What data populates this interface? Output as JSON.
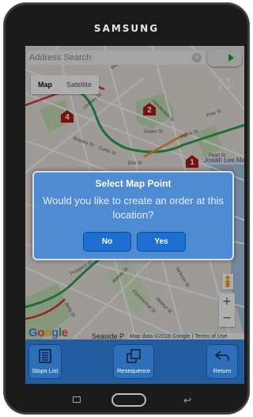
{
  "device": {
    "brand": "SAMSUNG"
  },
  "map": {
    "search_placeholder": "Address Search",
    "maptype": {
      "map_label": "Map",
      "satellite_label": "Satellite",
      "selected": "Map"
    },
    "pins": [
      {
        "number": "4"
      },
      {
        "number": "2"
      },
      {
        "number": "1"
      }
    ],
    "google_logo": "Google",
    "attribution": "Map data ©2018 Google | Terms of Use",
    "place_label": "Seaside P",
    "street_labels": [
      "Green St",
      "Curtis St",
      "Elm St",
      "Harris St",
      "Prospect St",
      "Commercial St",
      "Walnut St",
      "Market St",
      "Henderson St",
      "Pine St",
      "Pearl St",
      "Jerry St",
      "Bowers St",
      "Lindsey St",
      "Jackson St",
      "Maple St"
    ],
    "poi_label": "Josiah Lee Ma",
    "colors": {
      "pin": "#b0181a",
      "route_green": "#2ea44f",
      "route_red": "#d9352b",
      "water": "#a8c8e8"
    }
  },
  "dialog": {
    "title": "Select Map Point",
    "message": "Would you like to create an order at this location?",
    "no_label": "No",
    "yes_label": "Yes"
  },
  "toolbar": {
    "stops_list": "Stops List",
    "resequence": "Resequence",
    "return": "Return"
  },
  "icons": [
    "play-icon",
    "clear-icon",
    "fullscreen-icon",
    "map-pin-icon",
    "pegman-icon",
    "zoom-in-icon",
    "zoom-out-icon",
    "list-icon",
    "resequence-icon",
    "return-arrow-icon",
    "recent-apps-icon",
    "home-button-icon",
    "back-icon"
  ]
}
